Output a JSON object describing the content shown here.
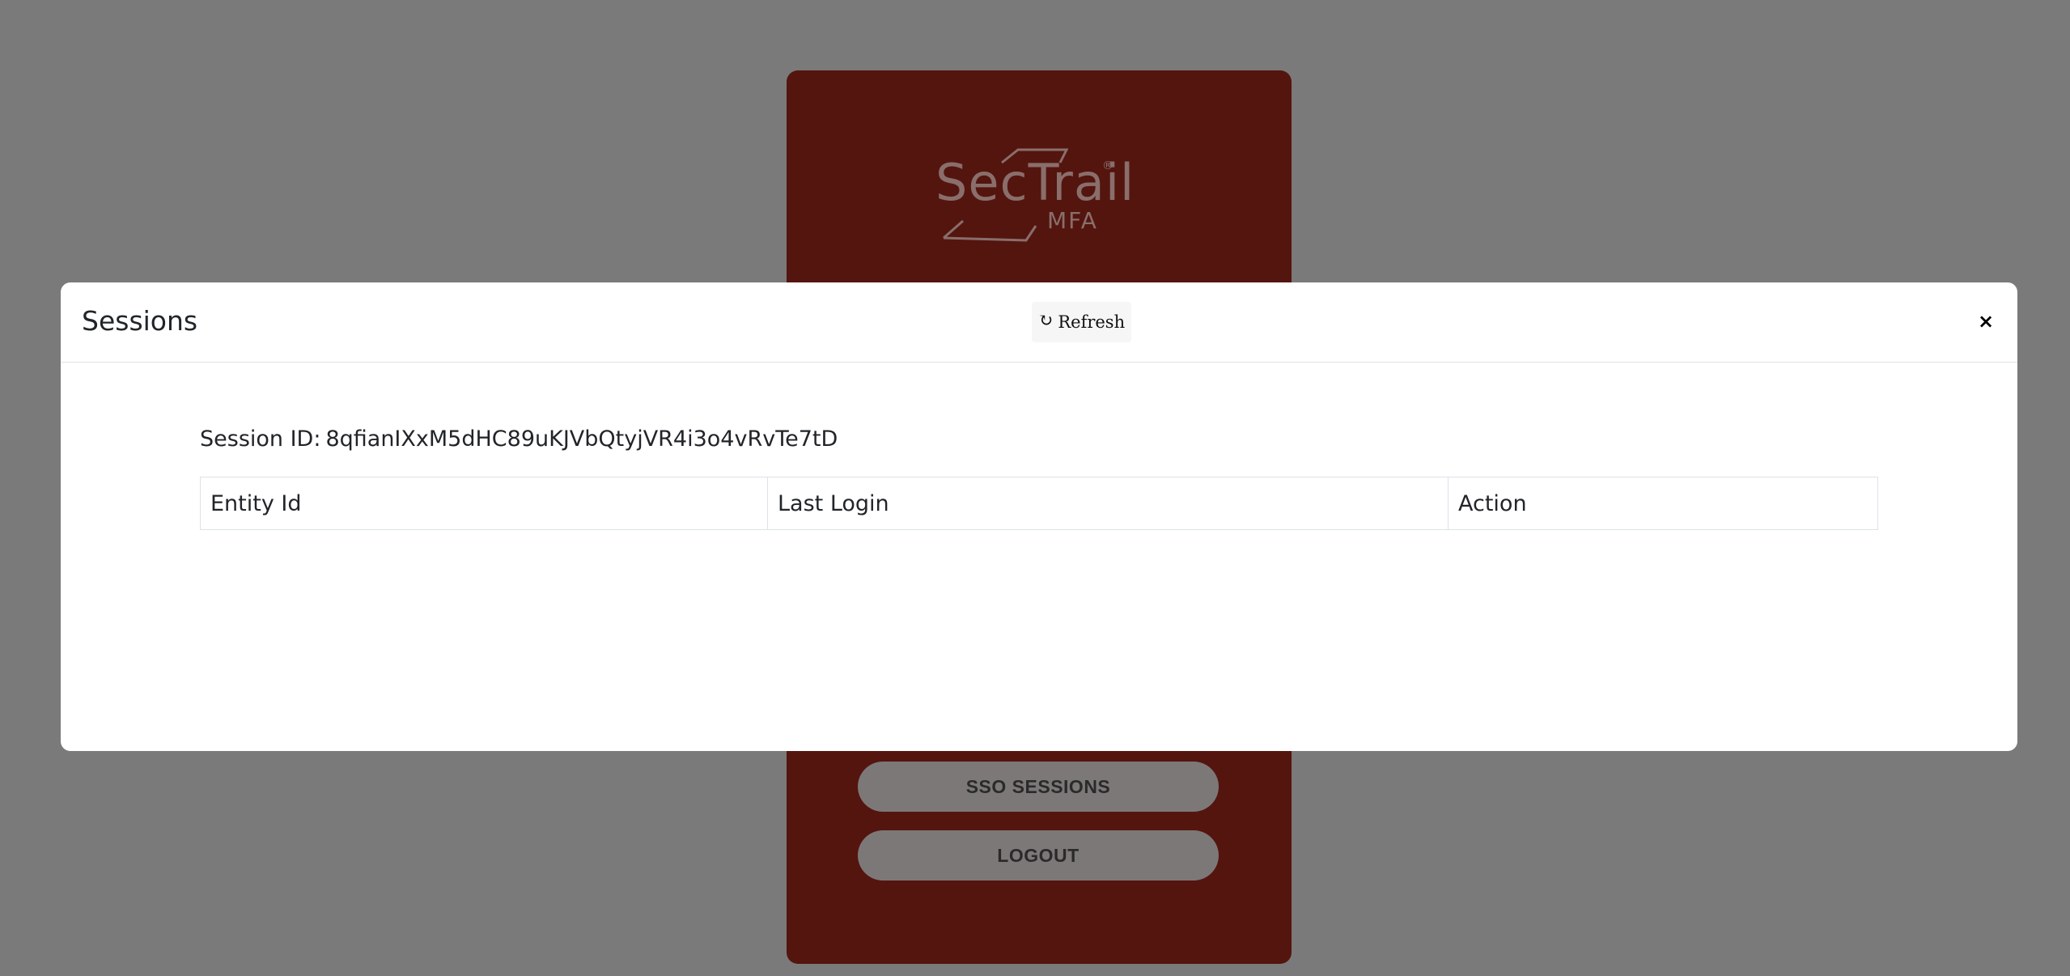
{
  "background_card": {
    "logo": {
      "name": "SecTrail",
      "registered_mark": "®",
      "subtitle": "MFA"
    },
    "buttons": {
      "sso_sessions": "SSO SESSIONS",
      "logout": "LOGOUT"
    }
  },
  "modal": {
    "title": "Sessions",
    "refresh_label": "Refresh",
    "refresh_icon": "↻",
    "close_label": "×",
    "session_id_label": "Session ID:",
    "session_id_value": "8qfianIXxM5dHC89uKJVbQtyjVR4i3o4vRvTe7tD",
    "table": {
      "headers": [
        "Entity Id",
        "Last Login",
        "Action"
      ],
      "rows": []
    }
  },
  "colors": {
    "overlay": "#7a7a7a",
    "card": "#54150f",
    "modal": "#ffffff"
  }
}
